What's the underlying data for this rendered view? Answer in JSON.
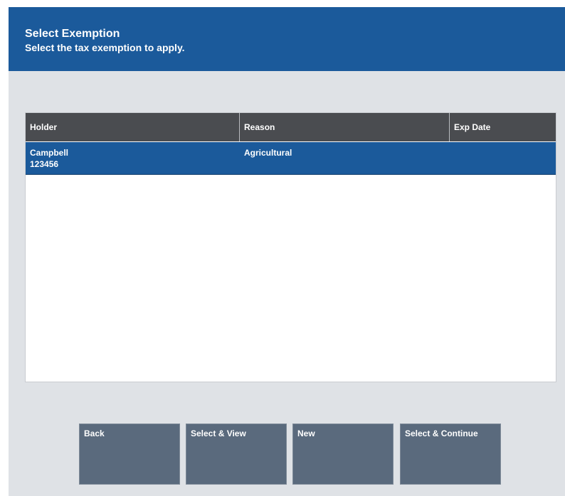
{
  "header": {
    "title": "Select Exemption",
    "subtitle": "Select the tax exemption to apply."
  },
  "table": {
    "columns": [
      "Holder",
      "Reason",
      "Exp Date"
    ],
    "rows": [
      {
        "holder_name": "Campbell",
        "holder_id": "123456",
        "reason": "Agricultural",
        "exp_date": "",
        "selected": true
      }
    ]
  },
  "buttons": {
    "back": "Back",
    "select_view": "Select & View",
    "new": "New",
    "select_continue": "Select & Continue"
  },
  "colors": {
    "header_bg": "#1b5a9b",
    "selected_row_bg": "#1b5a9b",
    "table_header_bg": "#4a4c50",
    "button_bg": "#5a6a7d",
    "panel_bg": "#dfe2e6"
  }
}
